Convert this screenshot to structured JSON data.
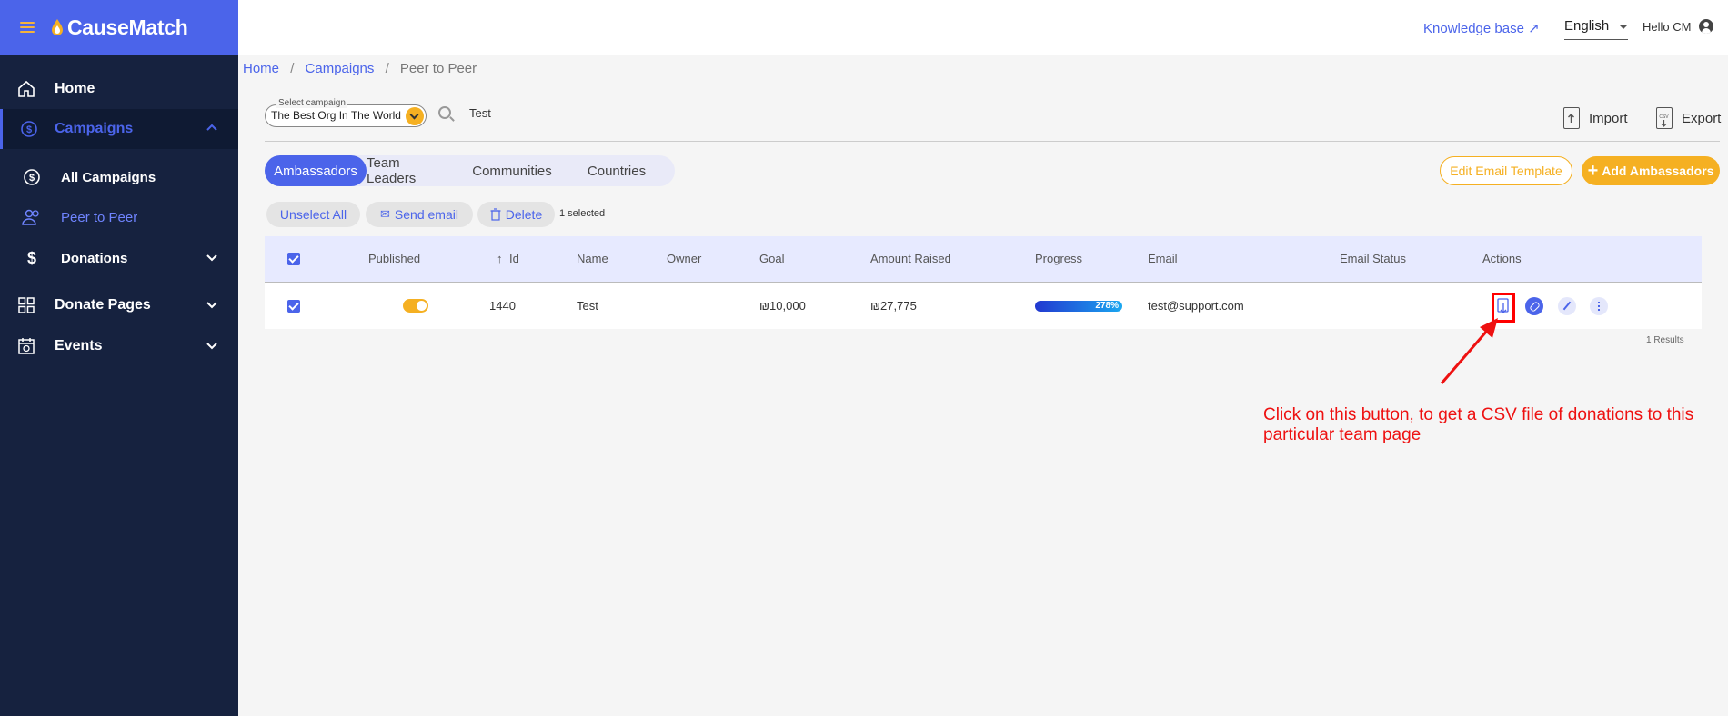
{
  "app": {
    "brand": "CauseMatch"
  },
  "sidebar": {
    "items": [
      {
        "label": "Home",
        "icon": "home-icon"
      },
      {
        "label": "Campaigns",
        "icon": "dollar-circle-icon",
        "expanded": true
      },
      {
        "label": "All Campaigns",
        "icon": "dollar-circle-icon"
      },
      {
        "label": "Peer to Peer",
        "icon": "users-icon",
        "current": true
      },
      {
        "label": "Donations",
        "icon": "dollar-icon"
      },
      {
        "label": "Donate Pages",
        "icon": "grid-icon"
      },
      {
        "label": "Events",
        "icon": "calendar-icon"
      }
    ]
  },
  "topbar": {
    "knowledge_base": "Knowledge base ↗",
    "language": "English",
    "greeting": "Hello CM"
  },
  "breadcrumb": {
    "home": "Home",
    "campaigns": "Campaigns",
    "current": "Peer to Peer",
    "separator": "/"
  },
  "filters": {
    "campaign_label": "Select campaign",
    "campaign_value": "The Best Org In The World",
    "search_value": "Test"
  },
  "header_actions": {
    "import": "Import",
    "export": "Export"
  },
  "tabs": [
    {
      "label": "Ambassadors",
      "active": true
    },
    {
      "label": "Team Leaders"
    },
    {
      "label": "Communities"
    },
    {
      "label": "Countries"
    }
  ],
  "buttons": {
    "edit_template": "Edit Email Template",
    "add_ambassadors": "Add Ambassadors",
    "unselect_all": "Unselect All",
    "send_email": "Send email",
    "delete": "Delete",
    "selected_count": "1 selected"
  },
  "table": {
    "columns": {
      "published": "Published",
      "id": "Id",
      "name": "Name",
      "owner": "Owner",
      "goal": "Goal",
      "amount_raised": "Amount Raised",
      "progress": "Progress",
      "email": "Email",
      "email_status": "Email Status",
      "actions": "Actions"
    },
    "sort_indicator": "↑",
    "rows": [
      {
        "selected": true,
        "published": true,
        "id": "1440",
        "name": "Test",
        "owner": "",
        "goal": "₪10,000",
        "amount_raised": "₪27,775",
        "progress": "278%",
        "progress_value": 2.78,
        "email": "test@support.com",
        "email_status": ""
      }
    ],
    "results": "1 Results"
  },
  "annotation": {
    "text": "Click on this button, to get a CSV file of donations to this particular team page",
    "color": "#ee1111"
  },
  "colors": {
    "primary": "#4b64ea",
    "accent": "#f5b022",
    "sidebar": "#16223f"
  }
}
